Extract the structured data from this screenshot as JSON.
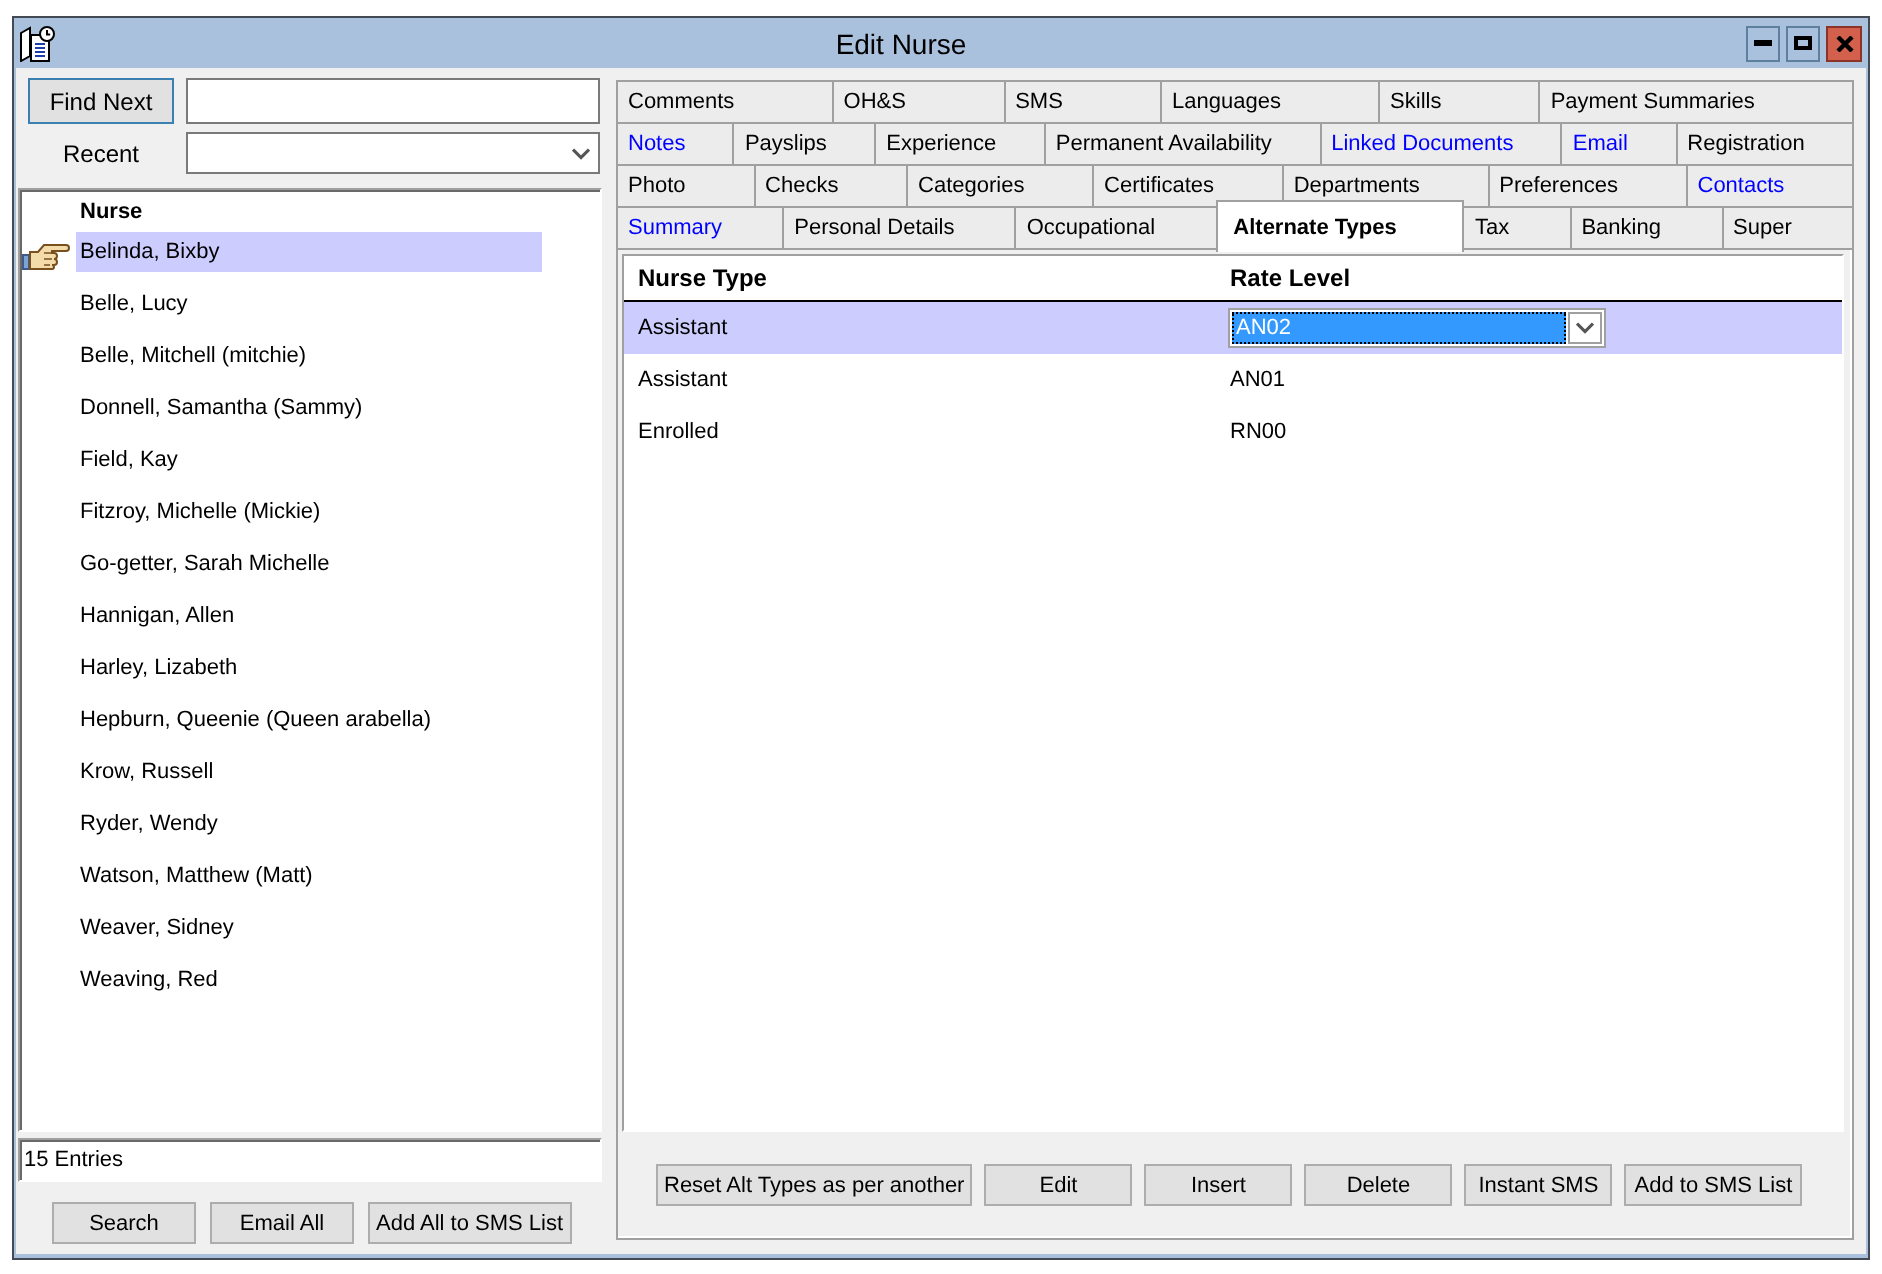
{
  "window": {
    "title": "Edit Nurse"
  },
  "find": {
    "button": "Find Next"
  },
  "recent": {
    "label": "Recent"
  },
  "nurse_list": {
    "column": "Nurse",
    "rows": [
      {
        "name": "Belinda, Bixby",
        "selected": true
      },
      {
        "name": "Belle, Lucy",
        "selected": false
      },
      {
        "name": "Belle, Mitchell (mitchie)",
        "selected": false
      },
      {
        "name": "Donnell, Samantha (Sammy)",
        "selected": false
      },
      {
        "name": "Field, Kay",
        "selected": false
      },
      {
        "name": "Fitzroy, Michelle (Mickie)",
        "selected": false
      },
      {
        "name": "Go-getter, Sarah Michelle",
        "selected": false
      },
      {
        "name": "Hannigan, Allen",
        "selected": false
      },
      {
        "name": "Harley, Lizabeth",
        "selected": false
      },
      {
        "name": "Hepburn, Queenie (Queen arabella)",
        "selected": false
      },
      {
        "name": "Krow, Russell",
        "selected": false
      },
      {
        "name": "Ryder, Wendy",
        "selected": false
      },
      {
        "name": "Watson, Matthew (Matt)",
        "selected": false
      },
      {
        "name": "Weaver, Sidney",
        "selected": false
      },
      {
        "name": "Weaving, Red",
        "selected": false
      }
    ]
  },
  "entry_count": "15 Entries",
  "list_buttons": [
    "Search",
    "Email All",
    "Add All to SMS List"
  ],
  "tab_rows": [
    [
      {
        "label": "Comments",
        "selected": false,
        "color": "#000000"
      },
      {
        "label": "OH&S",
        "selected": false,
        "color": "#000000"
      },
      {
        "label": "SMS",
        "selected": false,
        "color": "#000000"
      },
      {
        "label": "Languages",
        "selected": false,
        "color": "#000000"
      },
      {
        "label": "Skills",
        "selected": false,
        "color": "#000000"
      },
      {
        "label": "Payment Summaries",
        "selected": false,
        "color": "#000000"
      }
    ],
    [
      {
        "label": "Notes",
        "selected": false,
        "color": "#0000ff"
      },
      {
        "label": "Payslips",
        "selected": false,
        "color": "#000000"
      },
      {
        "label": "Experience",
        "selected": false,
        "color": "#000000"
      },
      {
        "label": "Permanent Availability",
        "selected": false,
        "color": "#000000"
      },
      {
        "label": "Linked Documents",
        "selected": false,
        "color": "#0000ff"
      },
      {
        "label": "Email",
        "selected": false,
        "color": "#0000ff"
      },
      {
        "label": "Registration",
        "selected": false,
        "color": "#000000"
      }
    ],
    [
      {
        "label": "Photo",
        "selected": false,
        "color": "#000000"
      },
      {
        "label": "Checks",
        "selected": false,
        "color": "#000000"
      },
      {
        "label": "Categories",
        "selected": false,
        "color": "#000000"
      },
      {
        "label": "Certificates",
        "selected": false,
        "color": "#000000"
      },
      {
        "label": "Departments",
        "selected": false,
        "color": "#000000"
      },
      {
        "label": "Preferences",
        "selected": false,
        "color": "#000000"
      },
      {
        "label": "Contacts",
        "selected": false,
        "color": "#0000ff"
      }
    ],
    [
      {
        "label": "Summary",
        "selected": false,
        "color": "#0000ff"
      },
      {
        "label": "Personal Details",
        "selected": false,
        "color": "#000000"
      },
      {
        "label": "Occupational",
        "selected": false,
        "color": "#000000"
      },
      {
        "label": "Alternate Types",
        "selected": true,
        "color": "#000000"
      },
      {
        "label": "Tax",
        "selected": false,
        "color": "#000000"
      },
      {
        "label": "Banking",
        "selected": false,
        "color": "#000000"
      },
      {
        "label": "Super",
        "selected": false,
        "color": "#000000"
      }
    ]
  ],
  "grid": {
    "columns": [
      "Nurse Type",
      "Rate Level"
    ],
    "rows": [
      {
        "nurse_type": "Assistant",
        "rate_level": "AN02",
        "selected": true
      },
      {
        "nurse_type": "Assistant",
        "rate_level": "AN01",
        "selected": false
      },
      {
        "nurse_type": "Enrolled",
        "rate_level": "RN00",
        "selected": false
      }
    ]
  },
  "buttons": [
    "Reset Alt Types as per another",
    "Edit",
    "Insert",
    "Delete",
    "Instant SMS",
    "Add to SMS List"
  ]
}
